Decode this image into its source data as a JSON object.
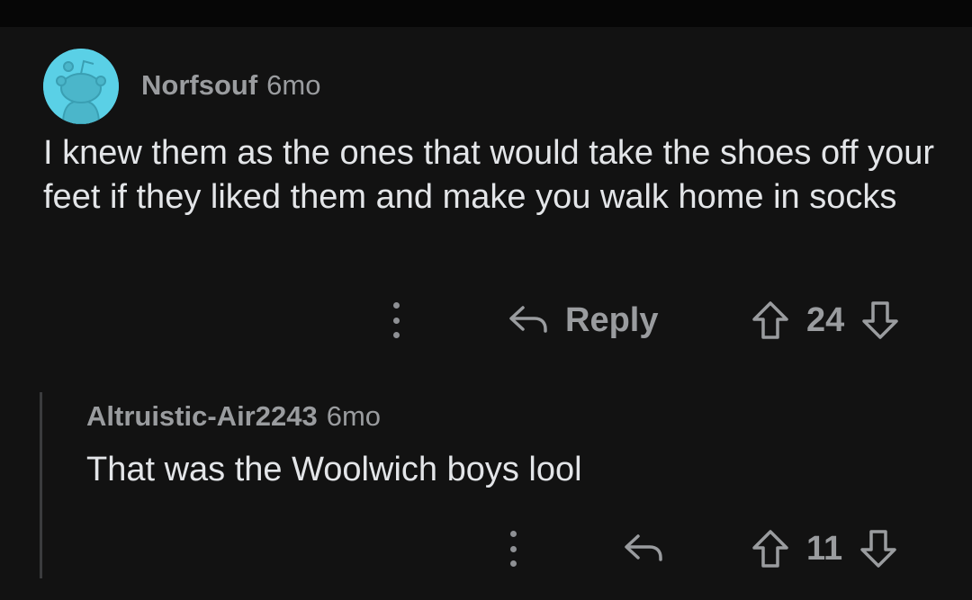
{
  "comment": {
    "author": "Norfsouf",
    "age": "6mo",
    "avatar_color": "#5ad0e6",
    "text": "I knew them as the ones that would take the shoes off your feet if they liked them and make you walk home in socks",
    "reply_label": "Reply",
    "score": "24",
    "icons": [
      "more-vertical-icon",
      "reply-arrow-icon",
      "upvote-arrow-icon",
      "downvote-arrow-icon"
    ]
  },
  "reply": {
    "author": "Altruistic-Air2243",
    "age": "6mo",
    "text": "That was the Woolwich boys lool",
    "score": "11",
    "icons": [
      "more-vertical-icon",
      "reply-arrow-icon",
      "upvote-arrow-icon",
      "downvote-arrow-icon"
    ]
  },
  "colors": {
    "background": "#121212",
    "text": "#e3e5e8",
    "muted": "#9a9c9f",
    "thread_line": "#3a3b3d"
  }
}
